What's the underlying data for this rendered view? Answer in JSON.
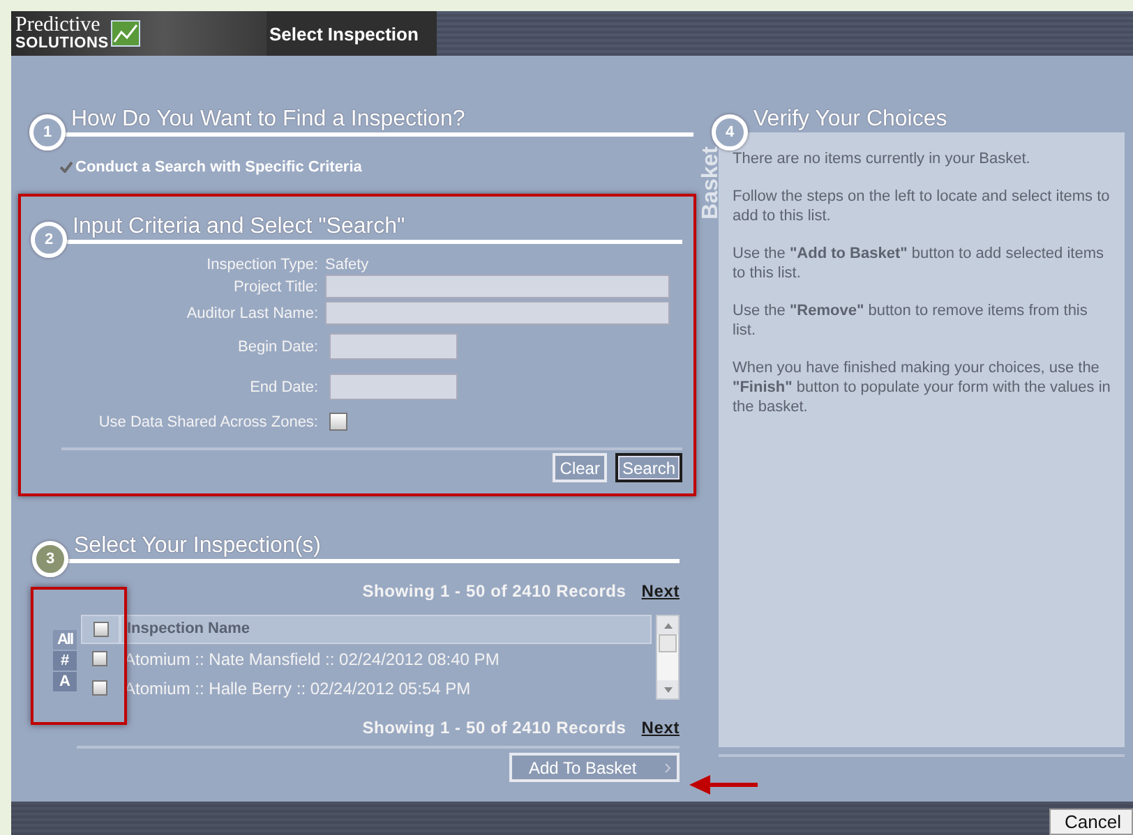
{
  "header": {
    "logo_top": "Predictive",
    "logo_bottom": "SOLUTIONS",
    "title": "Select Inspection"
  },
  "steps": [
    {
      "number": "1",
      "title": "How Do You Want to Find a Inspection?",
      "active": false
    },
    {
      "number": "2",
      "title": "Input Criteria and Select \"Search\"",
      "active": false
    },
    {
      "number": "3",
      "title": "Select Your Inspection(s)",
      "active": true
    },
    {
      "number": "4",
      "title": "Verify Your Choices",
      "active": false
    }
  ],
  "find_option": {
    "label": "Conduct a Search with Specific Criteria",
    "checked": true
  },
  "criteria": {
    "fields": [
      {
        "kind": "static",
        "label": "Inspection Type:",
        "value": "Safety"
      },
      {
        "kind": "text",
        "label": "Project Title:"
      },
      {
        "kind": "text",
        "label": "Auditor Last Name:"
      },
      {
        "kind": "date",
        "label": "Begin Date:"
      },
      {
        "kind": "date",
        "label": "End Date:"
      },
      {
        "kind": "checkbox",
        "label": "Use Data Shared Across Zones:",
        "checked": false
      }
    ],
    "buttons": [
      {
        "label": "Clear",
        "focused": false
      },
      {
        "label": "Search",
        "focused": true
      }
    ]
  },
  "results": {
    "paging_top": {
      "text": "Showing 1 - 50 of 2410 Records",
      "link": "Next"
    },
    "index": [
      "All",
      "#",
      "A"
    ],
    "column": "Inspection Name",
    "select_all": false,
    "rows": [
      {
        "name": "Atomium :: Nate Mansfield :: 02/24/2012 08:40 PM",
        "checked": false
      },
      {
        "name": "Atomium :: Halle Berry :: 02/24/2012 05:54 PM",
        "checked": false
      }
    ],
    "paging_bottom": {
      "text": "Showing 1 - 50 of 2410 Records",
      "link": "Next"
    },
    "add_button": "Add To Basket"
  },
  "basket": {
    "tab": "Basket",
    "paragraphs": [
      "There are no items currently in your Basket.",
      "Follow the steps on the left to locate and select items to add to this list.",
      "Use the **\"Add to Basket\"** button to add selected items to this list.",
      "Use the **\"Remove\"** button to remove items from this list.",
      "When you have finished making your choices, use the **\"Finish\"** button to populate your form with the values in the basket."
    ]
  },
  "footer": {
    "cancel": "Cancel"
  }
}
